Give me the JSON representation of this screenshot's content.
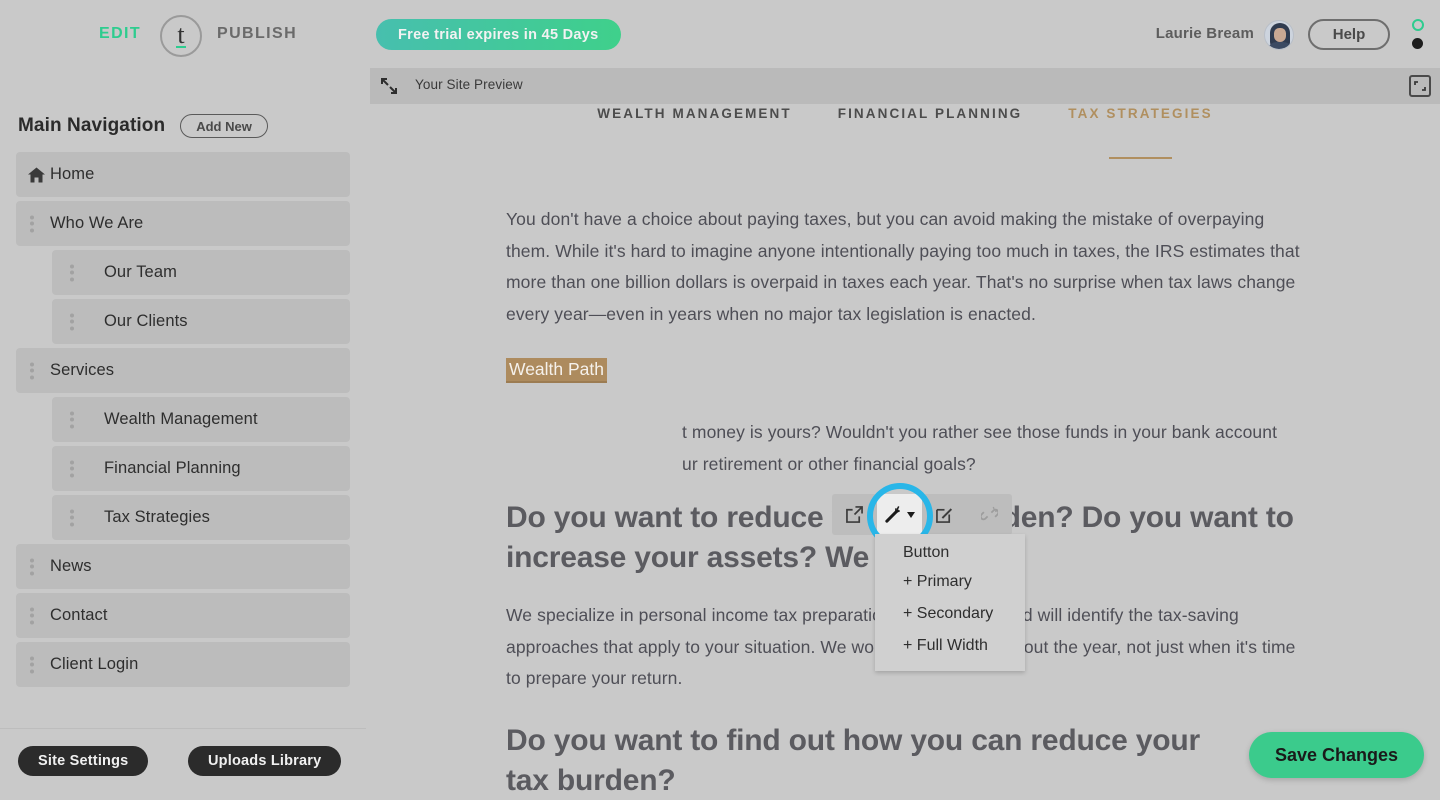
{
  "topbar": {
    "edit_label": "EDIT",
    "logo_letter": "t",
    "publish_label": "PUBLISH",
    "trial_notice": "Free trial expires in 45 Days",
    "user_name": "Laurie Bream",
    "help_label": "Help"
  },
  "sidebar": {
    "title": "Main Navigation",
    "add_new_label": "Add New",
    "items": [
      {
        "label": "Home",
        "level": 0,
        "icon": "home-icon"
      },
      {
        "label": "Who We Are",
        "level": 0,
        "icon": "grip-icon"
      },
      {
        "label": "Our Team",
        "level": 1,
        "icon": "grip-icon"
      },
      {
        "label": "Our Clients",
        "level": 1,
        "icon": "grip-icon"
      },
      {
        "label": "Services",
        "level": 0,
        "icon": "grip-icon"
      },
      {
        "label": "Wealth Management",
        "level": 1,
        "icon": "grip-icon"
      },
      {
        "label": "Financial Planning",
        "level": 1,
        "icon": "grip-icon"
      },
      {
        "label": "Tax Strategies",
        "level": 1,
        "icon": "grip-icon"
      },
      {
        "label": "News",
        "level": 0,
        "icon": "grip-icon"
      },
      {
        "label": "Contact",
        "level": 0,
        "icon": "grip-icon"
      },
      {
        "label": "Client Login",
        "level": 0,
        "icon": "grip-icon"
      }
    ],
    "footer": {
      "site_settings": "Site Settings",
      "uploads_library": "Uploads Library"
    }
  },
  "preview": {
    "label": "Your Site Preview",
    "site_nav": [
      {
        "label": "WEALTH MANAGEMENT",
        "active": false
      },
      {
        "label": "FINANCIAL PLANNING",
        "active": false
      },
      {
        "label": "TAX STRATEGIES",
        "active": true
      }
    ],
    "paragraph_1": "You don't have a choice about paying taxes, but you can avoid making the mistake of overpaying them. While it's hard to imagine anyone intentionally paying too much in taxes, the IRS estimates that more than one billion dollars is overpaid in taxes each year. That's no surprise when tax laws change every year—even in years when no major tax legislation is enacted.",
    "selected_link_text": "Wealth Path",
    "paragraph_2_line_1": "t money is yours? Wouldn't you rather see those funds in your bank account",
    "paragraph_2_line_2": "ur retirement or other financial goals?",
    "heading_1": "Do you want to reduce your tax burden? Do you want to increase your assets? We can help!",
    "paragraph_3": "We specialize in personal income tax preparation and planning and will identify the tax-saving approaches that apply to your situation. We work with you throughout the year, not just when it's time to prepare your return.",
    "heading_2_line_1": "Do you want to find out how you can reduce your",
    "heading_2_line_2": "tax burden?"
  },
  "link_toolbar": {
    "buttons": [
      {
        "name": "open-link-icon"
      },
      {
        "name": "magic-wand-icon"
      },
      {
        "name": "edit-link-icon"
      },
      {
        "name": "unlink-icon"
      }
    ]
  },
  "dropdown": {
    "header": "Button",
    "items": [
      "+ Primary",
      "+ Secondary",
      "+ Full Width"
    ]
  },
  "save": {
    "label": "Save Changes"
  },
  "colors": {
    "accent_green": "#2ecc8f",
    "save_green": "#3bcb8c",
    "link_tan": "#ad8b5e",
    "focus_blue": "#29b6e8",
    "panel_gray": "#c9c9c9"
  }
}
